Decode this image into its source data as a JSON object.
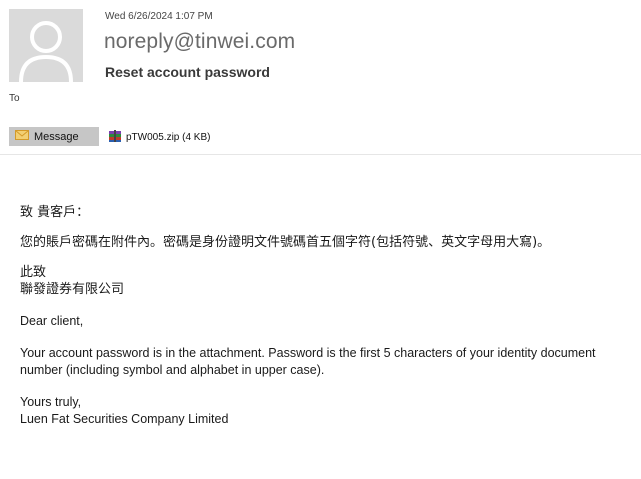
{
  "header": {
    "date": "Wed 6/26/2024 1:07 PM",
    "from": "noreply@tinwei.com",
    "subject": "Reset account password",
    "to_label": "To"
  },
  "attachments": {
    "message_tab": "Message",
    "file_label": "pTW005.zip (4 KB)"
  },
  "body": {
    "zh_greeting": "致 貴客戶：",
    "zh_paragraph": "您的賬戶密碼在附件內。密碼是身份證明文件號碼首五個字符(包括符號、英文字母用大寫)。",
    "zh_closing_1": "此致",
    "zh_closing_2": "聯發證券有限公司",
    "en_greeting": "Dear client,",
    "en_paragraph": "Your account password is in the attachment. Password is the first 5 characters of your identity document number (including symbol and alphabet in upper case).",
    "en_closing_1": "Yours truly,",
    "en_closing_2": "Luen Fat Securities Company Limited"
  },
  "icons": [
    "contact-avatar-icon",
    "envelope-icon",
    "zip-archive-icon"
  ],
  "colors": {
    "avatar_bg": "#dadada",
    "tab_bg": "#c6c6c6",
    "envelope": "#e8b84a"
  }
}
